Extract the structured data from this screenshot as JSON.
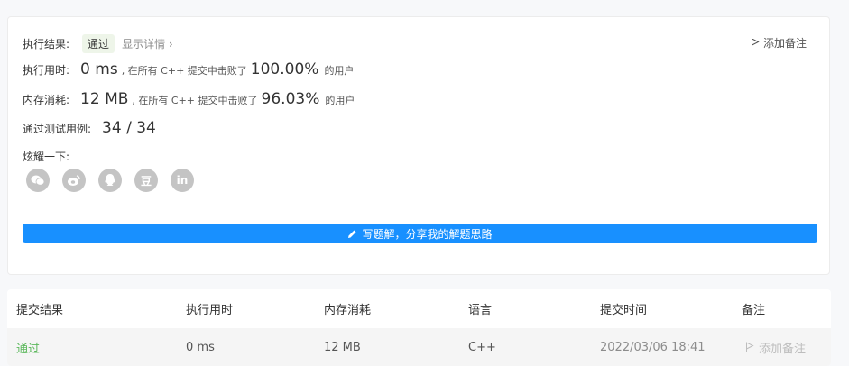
{
  "result": {
    "label": "执行结果:",
    "status": "通过",
    "details_link": "显示详情 ›",
    "add_note": "添加备注"
  },
  "runtime": {
    "label": "执行用时:",
    "value": "0 ms",
    "middle": ", 在所有 C++ 提交中击败了",
    "percent": "100.00%",
    "suffix": "的用户"
  },
  "memory": {
    "label": "内存消耗:",
    "value": "12 MB",
    "middle": ", 在所有 C++ 提交中击败了",
    "percent": "96.03%",
    "suffix": "的用户"
  },
  "tests": {
    "label": "通过测试用例:",
    "value": "34 / 34"
  },
  "share": {
    "label": "炫耀一下:",
    "buttons": [
      {
        "icon": "wechat-icon",
        "glyph": "●●"
      },
      {
        "icon": "weibo-icon",
        "glyph": "◎"
      },
      {
        "icon": "qq-icon",
        "glyph": "♞"
      },
      {
        "icon": "douban-icon",
        "glyph": "豆"
      },
      {
        "icon": "linkedin-icon",
        "glyph": "in"
      }
    ]
  },
  "write_solution": "写题解，分享我的解题思路",
  "table": {
    "headers": [
      "提交结果",
      "执行用时",
      "内存消耗",
      "语言",
      "提交时间",
      "备注"
    ],
    "rows": [
      {
        "result": "通过",
        "runtime": "0 ms",
        "memory": "12 MB",
        "language": "C++",
        "time": "2022/03/06 18:41",
        "note": "添加备注"
      }
    ]
  },
  "colors": {
    "accent": "#1890ff",
    "success": "#5cb85c",
    "icon_gray": "#c4c4c4"
  }
}
